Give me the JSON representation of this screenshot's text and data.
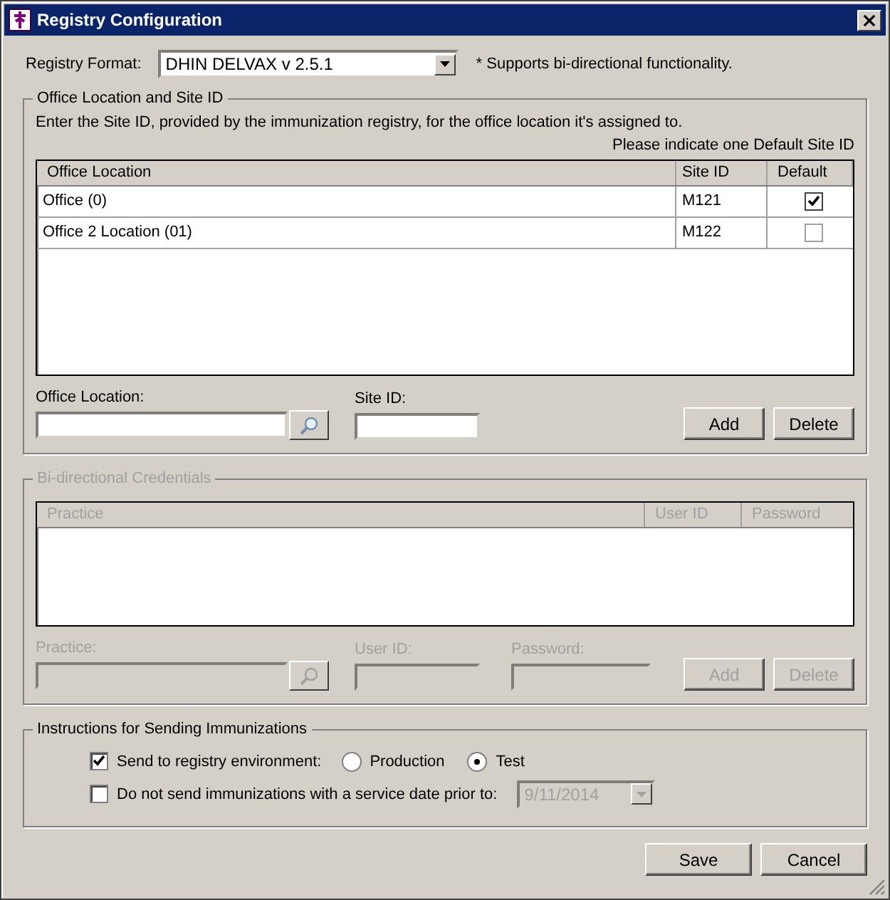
{
  "window": {
    "title": "Registry Configuration"
  },
  "registry_format": {
    "label": "Registry Format:",
    "value": "DHIN DELVAX v 2.5.1",
    "note": "* Supports bi-directional functionality."
  },
  "office_section": {
    "title": "Office Location and Site ID",
    "instruction": "Enter the Site ID, provided by the immunization registry, for the office location it's assigned to.",
    "hint": "Please indicate one Default Site ID",
    "columns": [
      "Office Location",
      "Site ID",
      "Default"
    ],
    "rows": [
      {
        "location": "Office (0)",
        "site_id": "M121",
        "default": true
      },
      {
        "location": "Office 2 Location (01)",
        "site_id": "M122",
        "default": false
      }
    ],
    "fields": [
      {
        "label": "Office Location:",
        "kind": "search"
      },
      {
        "label": "Site ID:",
        "kind": "text"
      }
    ],
    "buttons": [
      "Add",
      "Delete"
    ]
  },
  "credentials_section": {
    "title": "Bi-directional Credentials",
    "disabled": true,
    "columns": [
      "Practice",
      "User ID",
      "Password"
    ],
    "fields": [
      {
        "label": "Practice:",
        "kind": "search"
      },
      {
        "label": "User ID:",
        "kind": "text"
      },
      {
        "label": "Password:",
        "kind": "text"
      }
    ],
    "buttons": [
      "Add",
      "Delete"
    ]
  },
  "instructions_section": {
    "title": "Instructions for Sending Immunizations",
    "send_env": {
      "label": "Send to registry environment:",
      "checked": true,
      "options": [
        {
          "label": "Production",
          "selected": false
        },
        {
          "label": "Test",
          "selected": true
        }
      ]
    },
    "date_limit": {
      "label": "Do not send immunizations with a service date prior to:",
      "checked": false,
      "value": "9/11/2014",
      "disabled": true
    }
  },
  "buttons": [
    "Save",
    "Cancel"
  ]
}
